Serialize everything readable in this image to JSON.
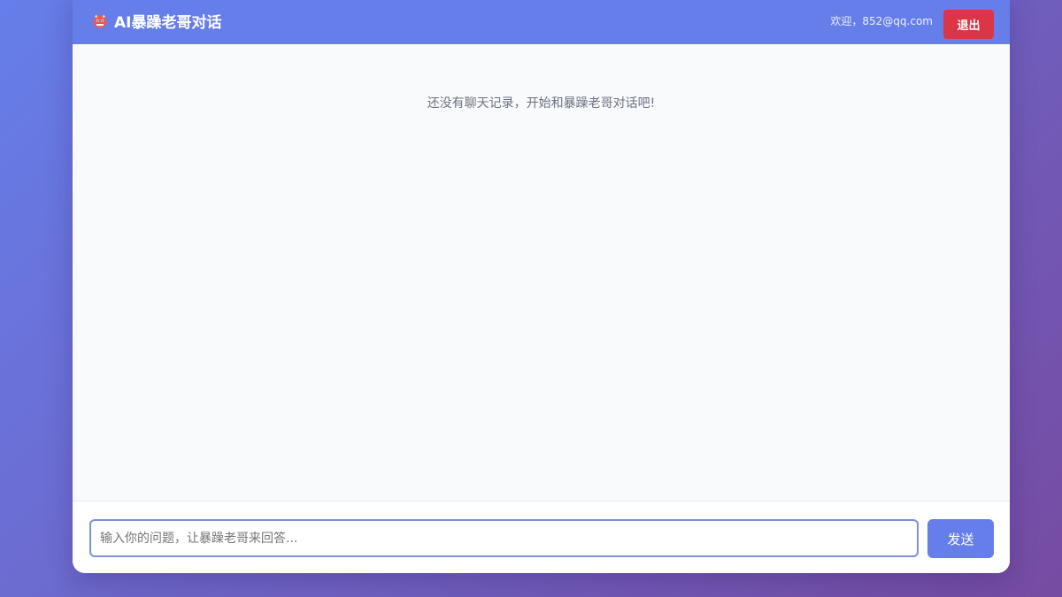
{
  "header": {
    "brand_icon": "ogre-face-icon",
    "title": "AI暴躁老哥对话",
    "welcome_text": "欢迎，852@qq.com",
    "logout_label": "退出"
  },
  "messages": {
    "empty_text": "还没有聊天记录，开始和暴躁老哥对话吧!"
  },
  "composer": {
    "input_value": "",
    "placeholder": "输入你的问题，让暴躁老哥来回答...",
    "send_label": "发送"
  },
  "colors": {
    "accent": "#667eea",
    "danger": "#dc3545",
    "background_gradient_start": "#667eea",
    "background_gradient_end": "#764ba2"
  }
}
